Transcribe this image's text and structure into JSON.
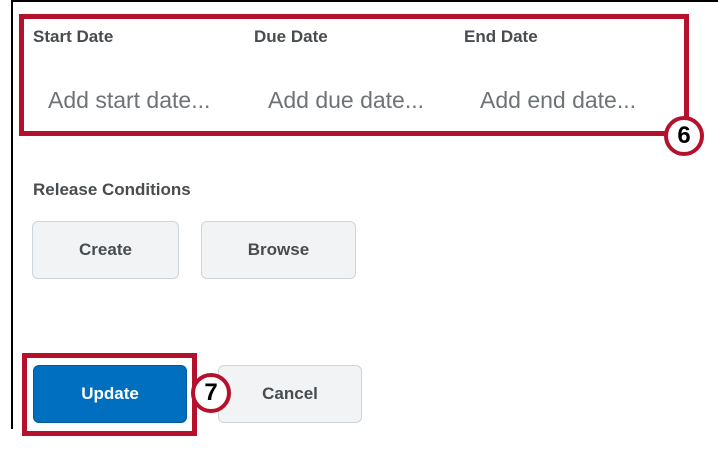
{
  "dates": {
    "start_label": "Start Date",
    "start_placeholder": "Add start date...",
    "due_label": "Due Date",
    "due_placeholder": "Add due date...",
    "end_label": "End Date",
    "end_placeholder": "Add end date..."
  },
  "release_conditions": {
    "label": "Release Conditions",
    "create_label": "Create",
    "browse_label": "Browse"
  },
  "actions": {
    "update_label": "Update",
    "cancel_label": "Cancel"
  },
  "callouts": {
    "dates_step": "6",
    "update_step": "7"
  },
  "colors": {
    "highlight": "#b5112d",
    "primary": "#006fbf"
  }
}
